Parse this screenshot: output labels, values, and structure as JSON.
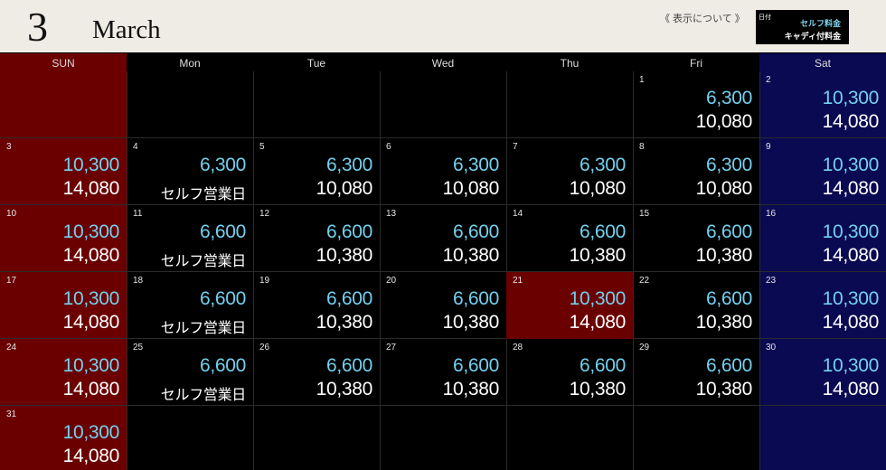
{
  "header": {
    "month_number": "3",
    "month_name": "March",
    "about_label": "《 表示について 》",
    "legend": {
      "date_label": "日付",
      "self_label": "セルフ料金",
      "caddie_label": "キャディ付料金"
    }
  },
  "colors": {
    "sunday_bg": "#6b0000",
    "saturday_bg": "#0a0a52",
    "highlight_bg": "#6b0000",
    "self_price": "#73d0ee"
  },
  "weekdays": [
    "SUN",
    "Mon",
    "Tue",
    "Wed",
    "Thu",
    "Fri",
    "Sat"
  ],
  "weeks": [
    [
      null,
      null,
      null,
      null,
      null,
      {
        "day": "1",
        "self": "6,300",
        "caddie": "10,080"
      },
      {
        "day": "2",
        "self": "10,300",
        "caddie": "14,080"
      }
    ],
    [
      {
        "day": "3",
        "self": "10,300",
        "caddie": "14,080"
      },
      {
        "day": "4",
        "self": "6,300",
        "caddie": "セルフ営業日"
      },
      {
        "day": "5",
        "self": "6,300",
        "caddie": "10,080"
      },
      {
        "day": "6",
        "self": "6,300",
        "caddie": "10,080"
      },
      {
        "day": "7",
        "self": "6,300",
        "caddie": "10,080"
      },
      {
        "day": "8",
        "self": "6,300",
        "caddie": "10,080"
      },
      {
        "day": "9",
        "self": "10,300",
        "caddie": "14,080"
      }
    ],
    [
      {
        "day": "10",
        "self": "10,300",
        "caddie": "14,080"
      },
      {
        "day": "11",
        "self": "6,600",
        "caddie": "セルフ営業日"
      },
      {
        "day": "12",
        "self": "6,600",
        "caddie": "10,380"
      },
      {
        "day": "13",
        "self": "6,600",
        "caddie": "10,380"
      },
      {
        "day": "14",
        "self": "6,600",
        "caddie": "10,380"
      },
      {
        "day": "15",
        "self": "6,600",
        "caddie": "10,380"
      },
      {
        "day": "16",
        "self": "10,300",
        "caddie": "14,080"
      }
    ],
    [
      {
        "day": "17",
        "self": "10,300",
        "caddie": "14,080"
      },
      {
        "day": "18",
        "self": "6,600",
        "caddie": "セルフ営業日"
      },
      {
        "day": "19",
        "self": "6,600",
        "caddie": "10,380"
      },
      {
        "day": "20",
        "self": "6,600",
        "caddie": "10,380"
      },
      {
        "day": "21",
        "self": "10,300",
        "caddie": "14,080",
        "holiday": true
      },
      {
        "day": "22",
        "self": "6,600",
        "caddie": "10,380"
      },
      {
        "day": "23",
        "self": "10,300",
        "caddie": "14,080"
      }
    ],
    [
      {
        "day": "24",
        "self": "10,300",
        "caddie": "14,080"
      },
      {
        "day": "25",
        "self": "6,600",
        "caddie": "セルフ営業日"
      },
      {
        "day": "26",
        "self": "6,600",
        "caddie": "10,380"
      },
      {
        "day": "27",
        "self": "6,600",
        "caddie": "10,380"
      },
      {
        "day": "28",
        "self": "6,600",
        "caddie": "10,380"
      },
      {
        "day": "29",
        "self": "6,600",
        "caddie": "10,380"
      },
      {
        "day": "30",
        "self": "10,300",
        "caddie": "14,080"
      }
    ],
    [
      {
        "day": "31",
        "self": "10,300",
        "caddie": "14,080"
      },
      null,
      null,
      null,
      null,
      null,
      null
    ]
  ]
}
